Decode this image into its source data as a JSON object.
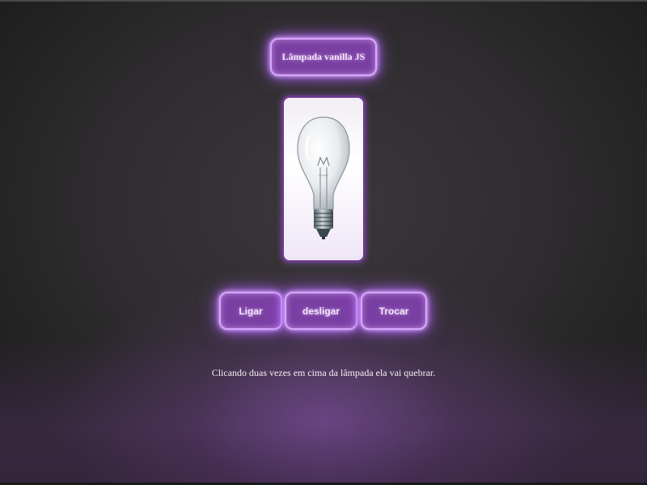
{
  "header": {
    "title_label": "Lâmpada vanilla JS"
  },
  "lamp": {
    "state": "off",
    "icon": "lightbulb-icon"
  },
  "controls": {
    "on_label": "Ligar",
    "off_label": "desligar",
    "swap_label": "Trocar"
  },
  "caption": {
    "text": "Clicando duas vezes em cima da lâmpada ela vai quebrar."
  },
  "colors": {
    "accent": "#b36bff",
    "button_fill": "#7a3fa3",
    "button_border": "#d9a6ff",
    "background": "#2f2d2f"
  }
}
